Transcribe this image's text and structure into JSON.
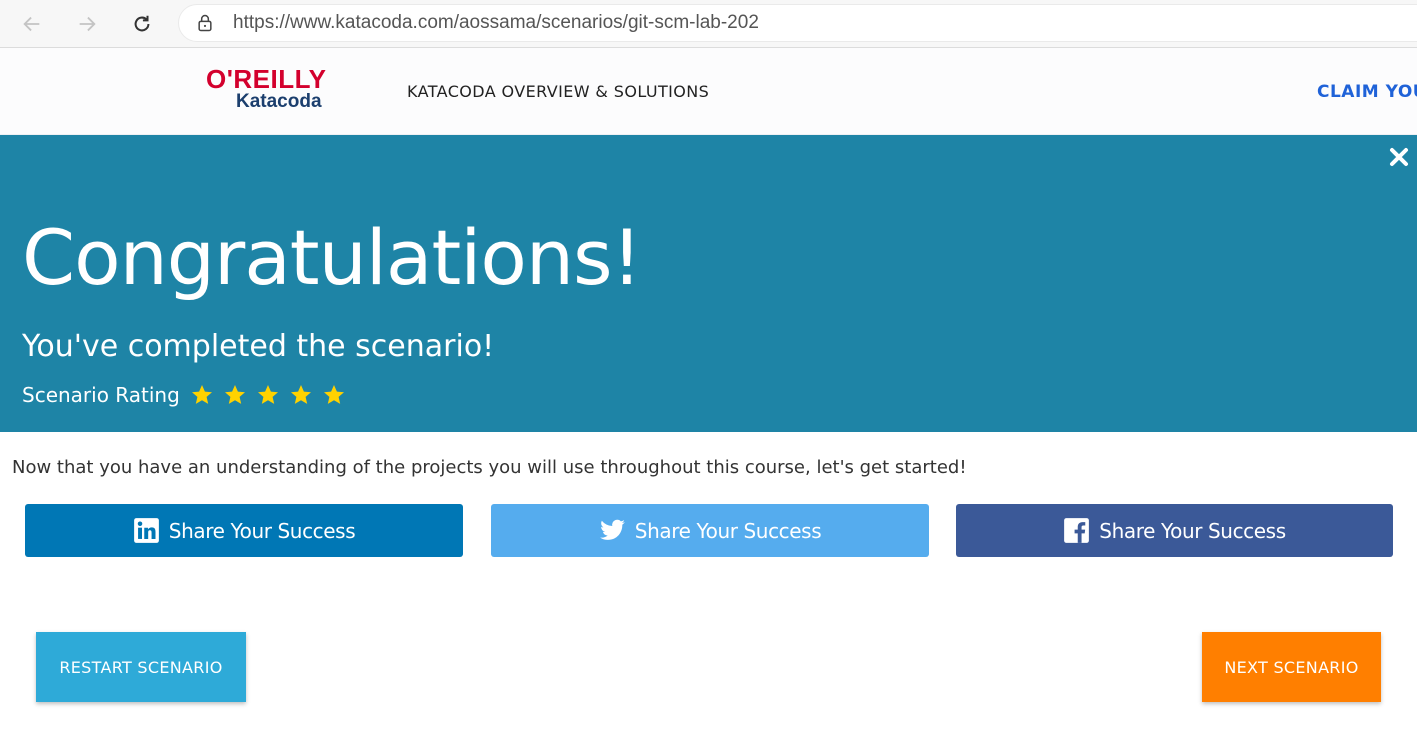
{
  "browser": {
    "url": "https://www.katacoda.com/aossama/scenarios/git-scm-lab-202",
    "back_icon": "arrow-left-icon",
    "forward_icon": "arrow-right-icon",
    "reload_icon": "reload-icon",
    "lock_icon": "lock-icon"
  },
  "header": {
    "logo_top": "O'REILLY",
    "logo_bottom": "Katacoda",
    "nav_link": "KATACODA OVERVIEW & SOLUTIONS",
    "claim_link": "CLAIM YOU"
  },
  "banner": {
    "title": "Congratulations!",
    "subtitle": "You've completed the scenario!",
    "rating_label": "Scenario Rating",
    "rating_value": 5,
    "rating_max": 5,
    "close_icon": "close-icon"
  },
  "lead_text": "Now that you have an understanding of the projects you will use throughout this course, let's get started!",
  "share_buttons": [
    {
      "label": "Share Your Success",
      "icon": "linkedin-icon",
      "color": "#0077b5"
    },
    {
      "label": "Share Your Success",
      "icon": "twitter-icon",
      "color": "#55acee"
    },
    {
      "label": "Share Your Success",
      "icon": "facebook-icon",
      "color": "#3b5998"
    }
  ],
  "actions": {
    "restart_label": "RESTART SCENARIO",
    "next_label": "NEXT SCENARIO",
    "restart_color": "#2eaad8",
    "next_color": "#ff7f00"
  },
  "colors": {
    "banner": "#1e84a6",
    "star": "#ffd200",
    "brand_red": "#d3002d",
    "link_blue": "#1f62d8"
  }
}
